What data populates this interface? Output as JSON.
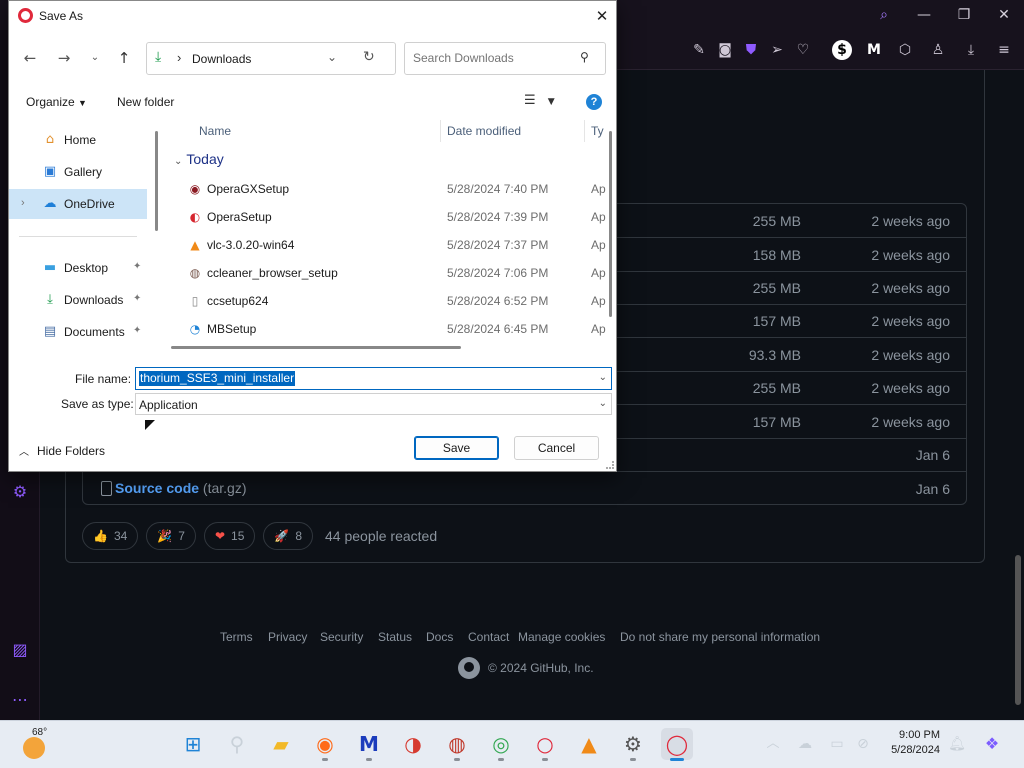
{
  "browser": {
    "window_controls": [
      "search-icon",
      "minimize-icon",
      "restore-icon",
      "close-icon"
    ],
    "toolbar_icons": [
      "edit-icon",
      "camera-icon",
      "shield-icon",
      "send-icon",
      "heart-icon",
      "dollar-icon",
      "malwarebytes-icon",
      "cube-icon",
      "account-icon",
      "download-icon",
      "menu-icon"
    ],
    "sidebar_icons": [
      "settings-icon",
      "gallery-icon",
      "more-icon"
    ],
    "accent_color": "#8f5bff"
  },
  "github": {
    "assets": [
      {
        "name": "",
        "size": "255 MB",
        "date": "2 weeks ago"
      },
      {
        "name": "",
        "size": "158 MB",
        "date": "2 weeks ago"
      },
      {
        "name": "",
        "size": "255 MB",
        "date": "2 weeks ago"
      },
      {
        "name": "",
        "size": "157 MB",
        "date": "2 weeks ago"
      },
      {
        "name": "",
        "size": "93.3 MB",
        "date": "2 weeks ago"
      },
      {
        "name": "",
        "size": "255 MB",
        "date": "2 weeks ago"
      },
      {
        "name": "",
        "size": "157 MB",
        "date": "2 weeks ago"
      },
      {
        "name": "",
        "size": "",
        "date": "Jan 6"
      },
      {
        "name": "Source code",
        "name_suffix": "(tar.gz)",
        "size": "",
        "date": "Jan 6"
      }
    ],
    "reactions": [
      {
        "emoji": "👍",
        "count": "34"
      },
      {
        "emoji": "🎉",
        "count": "7"
      },
      {
        "emoji": "❤",
        "count": "15"
      },
      {
        "emoji": "🚀",
        "count": "8"
      }
    ],
    "reactions_text": "44 people reacted",
    "footer_links": [
      "Terms",
      "Privacy",
      "Security",
      "Status",
      "Docs",
      "Contact",
      "Manage cookies",
      "Do not share my personal information"
    ],
    "copyright": "© 2024 GitHub, Inc."
  },
  "dialog": {
    "title": "Save As",
    "address": {
      "location": "Downloads"
    },
    "search_placeholder": "Search Downloads",
    "commands": {
      "organize": "Organize",
      "new_folder": "New folder"
    },
    "nav_items": [
      {
        "label": "Home",
        "icon": "home-icon"
      },
      {
        "label": "Gallery",
        "icon": "gallery-icon"
      },
      {
        "label": "OneDrive",
        "icon": "onedrive-icon",
        "selected": true
      },
      {
        "label": "Desktop",
        "icon": "desktop-icon",
        "pinned": true
      },
      {
        "label": "Downloads",
        "icon": "downloads-icon",
        "pinned": true
      },
      {
        "label": "Documents",
        "icon": "documents-icon",
        "pinned": true
      }
    ],
    "columns": {
      "name": "Name",
      "date_modified": "Date modified",
      "type": "Ty"
    },
    "group": "Today",
    "files": [
      {
        "name": "OperaGXSetup",
        "date": "5/28/2024 7:40 PM",
        "type": "Ap",
        "icon": "opera-gx-icon"
      },
      {
        "name": "OperaSetup",
        "date": "5/28/2024 7:39 PM",
        "type": "Ap",
        "icon": "opera-installer-icon"
      },
      {
        "name": "vlc-3.0.20-win64",
        "date": "5/28/2024 7:37 PM",
        "type": "Ap",
        "icon": "vlc-icon"
      },
      {
        "name": "ccleaner_browser_setup",
        "date": "5/28/2024 7:06 PM",
        "type": "Ap",
        "icon": "ccleaner-browser-icon"
      },
      {
        "name": "ccsetup624",
        "date": "5/28/2024 6:52 PM",
        "type": "Ap",
        "icon": "file-icon"
      },
      {
        "name": "MBSetup",
        "date": "5/28/2024 6:45 PM",
        "type": "Ap",
        "icon": "malwarebytes-setup-icon"
      }
    ],
    "file_name_label": "File name:",
    "file_name_value": "thorium_SSE3_mini_installer",
    "save_type_label": "Save as type:",
    "save_type_value": "Application",
    "hide_folders": "Hide Folders",
    "save_button": "Save",
    "cancel_button": "Cancel"
  },
  "taskbar": {
    "weather_temp": "68°",
    "apps": [
      "windows-start-icon",
      "search-icon",
      "file-explorer-icon",
      "firefox-icon",
      "malwarebytes-icon",
      "ccleaner-icon",
      "ccleaner-browser-icon",
      "chrome-icon",
      "opera-icon",
      "vlc-icon",
      "settings-icon",
      "opera-gx-icon"
    ],
    "tray_icons": [
      "chevron-up-icon",
      "onedrive-offline-icon",
      "display-icon",
      "network-icon",
      "notification-icon",
      "copilot-icon"
    ],
    "time": "9:00 PM",
    "date": "5/28/2024"
  }
}
